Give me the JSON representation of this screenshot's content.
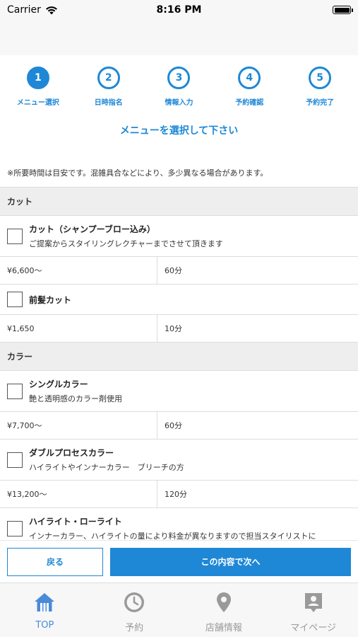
{
  "status_bar": {
    "carrier": "Carrier",
    "time": "8:16 PM"
  },
  "steps": [
    {
      "number": "1",
      "label": "メニュー選択",
      "active": true
    },
    {
      "number": "2",
      "label": "日時指名",
      "active": false
    },
    {
      "number": "3",
      "label": "情報入力",
      "active": false
    },
    {
      "number": "4",
      "label": "予約確認",
      "active": false
    },
    {
      "number": "5",
      "label": "予約完了",
      "active": false
    }
  ],
  "page_heading": "メニューを選択して下さい",
  "note": "※所要時間は目安です。混雑具合などにより、多少異なる場合があります。",
  "menu": {
    "cut": {
      "title": "カット",
      "items": [
        {
          "name": "カット（シャンプーブロー込み）",
          "description": "ご提案からスタイリングレクチャーまでさせて頂きます",
          "price": "¥6,600〜",
          "duration": "60分"
        },
        {
          "name": "前髪カット",
          "description": "",
          "price": "¥1,650",
          "duration": "10分"
        }
      ]
    },
    "color": {
      "title": "カラー",
      "items": [
        {
          "name": "シングルカラー",
          "description": "艶と透明感のカラー剤使用",
          "price": "¥7,700〜",
          "duration": "60分"
        },
        {
          "name": "ダブルプロセスカラー",
          "description": "ハイライトやインナーカラー　ブリーチの方",
          "price": "¥13,200〜",
          "duration": "120分"
        },
        {
          "name": "ハイライト・ローライト",
          "description": "インナーカラー、ハイライトの量により料金が異なりますので担当スタイリストに"
        }
      ]
    }
  },
  "actions": {
    "back": "戻る",
    "next": "この内容で次へ"
  },
  "tabbar": [
    {
      "label": "TOP",
      "icon": "home-icon",
      "active": true
    },
    {
      "label": "予約",
      "icon": "clock-icon",
      "active": false
    },
    {
      "label": "店舗情報",
      "icon": "location-pin-icon",
      "active": false
    },
    {
      "label": "マイページ",
      "icon": "person-badge-icon",
      "active": false
    }
  ],
  "colors": {
    "accent": "#1e88d6",
    "tab_active": "#4a8bd8",
    "tab_inactive": "#9a9a9a"
  }
}
